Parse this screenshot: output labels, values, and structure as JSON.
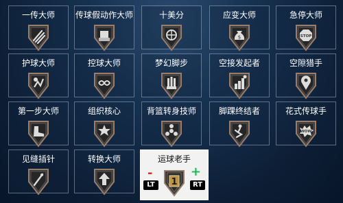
{
  "badges": [
    {
      "label": "一传大师",
      "icon": "pass-hand-icon"
    },
    {
      "label": "传球假动作大师",
      "icon": "fake-pass-icon"
    },
    {
      "label": "十美分",
      "icon": "dime-ball-icon"
    },
    {
      "label": "应变大师",
      "icon": "money-bag-icon"
    },
    {
      "label": "急停大师",
      "icon": "stop-sign-icon"
    },
    {
      "label": "护球大师",
      "icon": "ball-protect-icon"
    },
    {
      "label": "控球大师",
      "icon": "dribble-loop-icon"
    },
    {
      "label": "梦幻脚步",
      "icon": "dream-shake-icon"
    },
    {
      "label": "空接发起者",
      "icon": "alley-oop-icon"
    },
    {
      "label": "空隙猎手",
      "icon": "gap-pin-icon"
    },
    {
      "label": "第一步大师",
      "icon": "first-step-shoe-icon"
    },
    {
      "label": "组织核心",
      "icon": "floor-general-icon"
    },
    {
      "label": "背篮转身技师",
      "icon": "spin-icon"
    },
    {
      "label": "脚踝终结者",
      "icon": "ankle-breaker-icon"
    },
    {
      "label": "花式传球手",
      "icon": "wow-flashy-pass-icon"
    },
    {
      "label": "见缝插针",
      "icon": "needle-icon"
    },
    {
      "label": "转换大师",
      "icon": "transition-arrow-icon"
    }
  ],
  "selected": {
    "label": "运球老手",
    "tier": "1",
    "minus": "-",
    "plus": "+",
    "lt": "LT",
    "rt": "RT",
    "icon": "tier-badge-icon"
  },
  "colors": {
    "badge_face": "#3a3a3a",
    "badge_rim": "#9a7d6a",
    "minus": "#d93025",
    "plus": "#1db954"
  }
}
